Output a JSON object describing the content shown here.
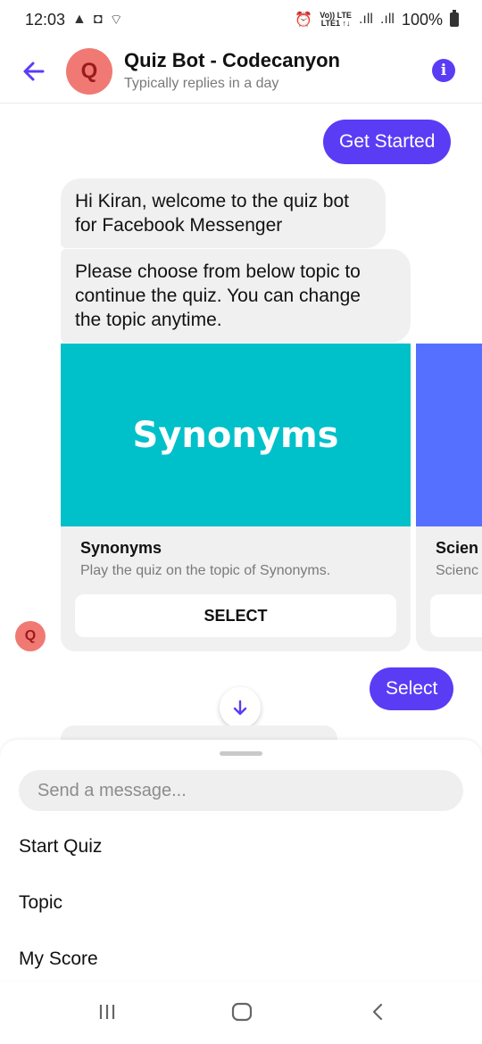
{
  "status_bar": {
    "time": "12:03",
    "battery": "100%",
    "left_icons": [
      "warning-icon",
      "outlook-icon",
      "wifi-question-icon"
    ],
    "network_text_1": "Vo)) LTE",
    "network_text_2": "LTE1 ↑↓"
  },
  "header": {
    "title": "Quiz Bot - Codecanyon",
    "subtitle": "Typically replies in a day",
    "avatar_letter": "Q"
  },
  "messages": {
    "user_get_started": "Get Started",
    "bot_welcome_line1": "Hi Kiran, welcome to the quiz bot",
    "bot_welcome_line2": "for Facebook Messenger",
    "bot_choose_line1": "Please choose from below topic to",
    "bot_choose_line2": "continue the quiz. You can change",
    "bot_choose_line3": "the topic anytime.",
    "user_select": "Select"
  },
  "carousel": [
    {
      "image_text": "Synonyms",
      "title": "Synonyms",
      "subtitle": "Play the quiz on the topic of Synonyms.",
      "button": "SELECT",
      "color": "#00c0c9"
    },
    {
      "title": "Scien",
      "subtitle": "Scienc",
      "color": "#5570ff"
    }
  ],
  "composer": {
    "placeholder": "Send a message..."
  },
  "quick_replies": [
    "Start Quiz",
    "Topic",
    "My Score"
  ],
  "colors": {
    "accent": "#5b3cf5",
    "avatar": "#f07a73",
    "bubble_bot": "#f0f0f0"
  }
}
